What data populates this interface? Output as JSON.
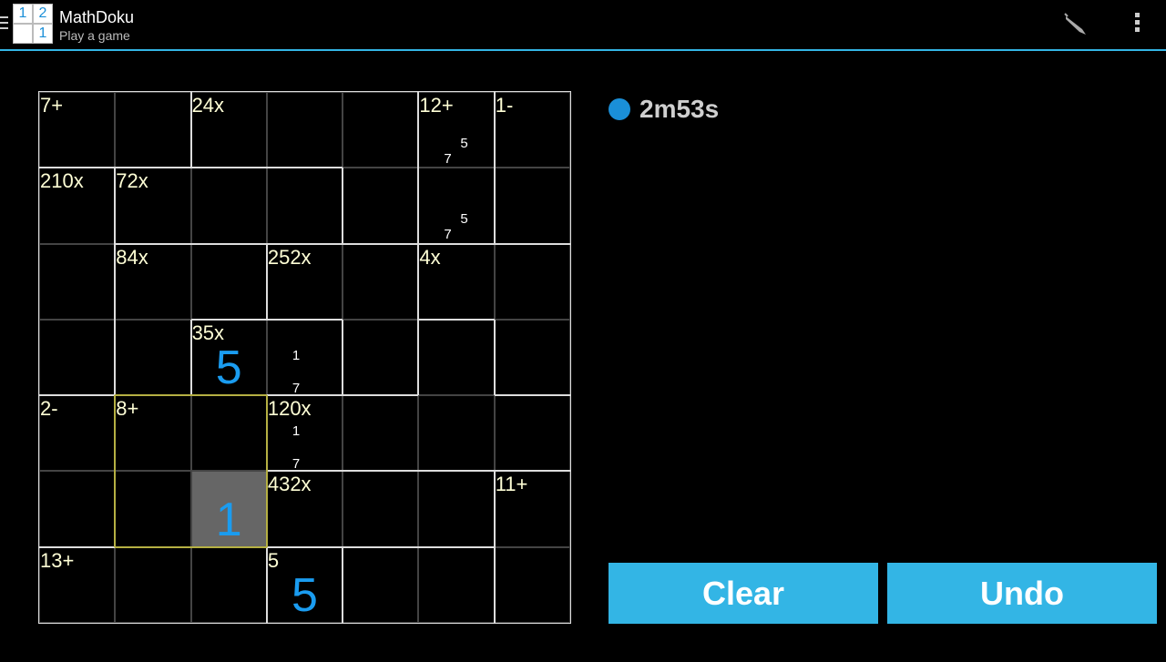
{
  "app": {
    "title": "MathDoku",
    "subtitle": "Play a game",
    "icon_digits": [
      "1",
      "2",
      "",
      "1"
    ]
  },
  "actions": {
    "pen_icon": "pen-icon",
    "overflow_icon": "overflow-menu-icon"
  },
  "timer": {
    "text": "2m53s"
  },
  "buttons": {
    "clear": "Clear",
    "undo": "Undo"
  },
  "colors": {
    "accent": "#33b5e5",
    "value": "#1a9cf0",
    "cage_label": "#ffffd6",
    "selected_cell": "#666666",
    "cage_highlight": "#b5b043"
  },
  "puzzle": {
    "size": 7,
    "cages": [
      {
        "label": "7+",
        "cells": [
          [
            0,
            0
          ],
          [
            0,
            1
          ]
        ]
      },
      {
        "label": "24x",
        "cells": [
          [
            0,
            2
          ],
          [
            0,
            3
          ],
          [
            0,
            4
          ],
          [
            1,
            4
          ]
        ]
      },
      {
        "label": "12+",
        "cells": [
          [
            0,
            5
          ],
          [
            1,
            5
          ]
        ]
      },
      {
        "label": "1-",
        "cells": [
          [
            0,
            6
          ],
          [
            1,
            6
          ]
        ]
      },
      {
        "label": "210x",
        "cells": [
          [
            1,
            0
          ],
          [
            2,
            0
          ],
          [
            3,
            0
          ]
        ]
      },
      {
        "label": "72x",
        "cells": [
          [
            1,
            1
          ],
          [
            1,
            2
          ],
          [
            1,
            3
          ]
        ]
      },
      {
        "label": "84x",
        "cells": [
          [
            2,
            1
          ],
          [
            2,
            2
          ],
          [
            3,
            1
          ]
        ]
      },
      {
        "label": "252x",
        "cells": [
          [
            2,
            3
          ],
          [
            2,
            4
          ],
          [
            3,
            4
          ]
        ]
      },
      {
        "label": "4x",
        "cells": [
          [
            2,
            5
          ],
          [
            2,
            6
          ],
          [
            3,
            6
          ]
        ]
      },
      {
        "label": "35x",
        "cells": [
          [
            3,
            2
          ],
          [
            3,
            3
          ]
        ]
      },
      {
        "label": "2-",
        "cells": [
          [
            4,
            0
          ],
          [
            5,
            0
          ]
        ]
      },
      {
        "label": "8+",
        "cells": [
          [
            4,
            1
          ],
          [
            4,
            2
          ],
          [
            5,
            1
          ],
          [
            5,
            2
          ]
        ]
      },
      {
        "label": "120x",
        "cells": [
          [
            4,
            3
          ],
          [
            4,
            4
          ],
          [
            4,
            5
          ],
          [
            4,
            6
          ],
          [
            3,
            5
          ]
        ]
      },
      {
        "label": "432x",
        "cells": [
          [
            5,
            3
          ],
          [
            5,
            4
          ],
          [
            5,
            5
          ]
        ]
      },
      {
        "label": "11+",
        "cells": [
          [
            5,
            6
          ],
          [
            6,
            6
          ]
        ]
      },
      {
        "label": "13+",
        "cells": [
          [
            6,
            0
          ],
          [
            6,
            1
          ],
          [
            6,
            2
          ]
        ]
      },
      {
        "label": "5",
        "cells": [
          [
            6,
            3
          ]
        ]
      },
      {
        "label": "",
        "cells": [
          [
            6,
            4
          ],
          [
            6,
            5
          ]
        ]
      }
    ],
    "values": [
      {
        "row": 3,
        "col": 2,
        "value": "5"
      },
      {
        "row": 5,
        "col": 2,
        "value": "1"
      },
      {
        "row": 6,
        "col": 3,
        "value": "5"
      }
    ],
    "memos": [
      {
        "row": 0,
        "col": 5,
        "numbers": [
          "7",
          "5"
        ]
      },
      {
        "row": 1,
        "col": 5,
        "numbers": [
          "7",
          "5"
        ]
      },
      {
        "row": 3,
        "col": 3,
        "numbers": [
          "1",
          "7"
        ]
      },
      {
        "row": 4,
        "col": 3,
        "numbers": [
          "1",
          "7"
        ]
      }
    ],
    "selected": {
      "row": 5,
      "col": 2
    },
    "highlighted_cage": "8+"
  }
}
